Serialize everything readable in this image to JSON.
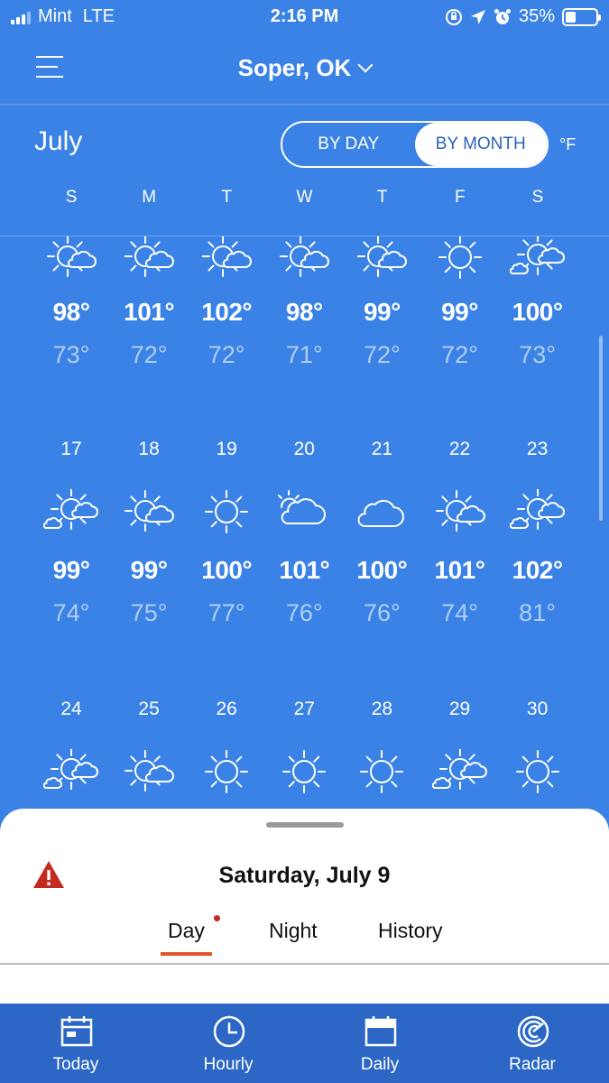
{
  "status_bar": {
    "carrier": "Mint",
    "network": "LTE",
    "time": "2:16 PM",
    "battery": "35%",
    "battery_level": 0.35
  },
  "header": {
    "location": "Soper, OK"
  },
  "calendar": {
    "month": "July",
    "toggle": {
      "by_day": "BY DAY",
      "by_month": "BY MONTH",
      "active": "by_month"
    },
    "unit": "°F",
    "weekdays": [
      "S",
      "M",
      "T",
      "W",
      "T",
      "F",
      "S"
    ],
    "weeks": [
      {
        "days": [
          {
            "date": "",
            "icon": "sun-cloud-icon",
            "hi": "98°",
            "lo": "73°"
          },
          {
            "date": "",
            "icon": "sun-cloud-icon",
            "hi": "101°",
            "lo": "72°"
          },
          {
            "date": "",
            "icon": "sun-cloud-icon",
            "hi": "102°",
            "lo": "72°"
          },
          {
            "date": "",
            "icon": "sun-cloud-icon",
            "hi": "98°",
            "lo": "71°"
          },
          {
            "date": "",
            "icon": "sun-cloud-icon",
            "hi": "99°",
            "lo": "72°"
          },
          {
            "date": "",
            "icon": "sun-icon",
            "hi": "99°",
            "lo": "72°"
          },
          {
            "date": "",
            "icon": "sun-clouds-icon",
            "hi": "100°",
            "lo": "73°"
          }
        ]
      },
      {
        "days": [
          {
            "date": "17",
            "icon": "sun-clouds-icon",
            "hi": "99°",
            "lo": "74°"
          },
          {
            "date": "18",
            "icon": "sun-cloud-icon",
            "hi": "99°",
            "lo": "75°"
          },
          {
            "date": "19",
            "icon": "sun-icon",
            "hi": "100°",
            "lo": "77°"
          },
          {
            "date": "20",
            "icon": "mostly-cloudy-icon",
            "hi": "101°",
            "lo": "76°"
          },
          {
            "date": "21",
            "icon": "cloud-icon",
            "hi": "100°",
            "lo": "76°"
          },
          {
            "date": "22",
            "icon": "sun-cloud-icon",
            "hi": "101°",
            "lo": "74°"
          },
          {
            "date": "23",
            "icon": "sun-clouds-icon",
            "hi": "102°",
            "lo": "81°"
          }
        ]
      },
      {
        "days": [
          {
            "date": "24",
            "icon": "sun-clouds-icon",
            "hi": "",
            "lo": ""
          },
          {
            "date": "25",
            "icon": "sun-cloud-icon",
            "hi": "",
            "lo": ""
          },
          {
            "date": "26",
            "icon": "sun-icon",
            "hi": "",
            "lo": ""
          },
          {
            "date": "27",
            "icon": "sun-icon",
            "hi": "",
            "lo": ""
          },
          {
            "date": "28",
            "icon": "sun-icon",
            "hi": "",
            "lo": ""
          },
          {
            "date": "29",
            "icon": "sun-clouds-icon",
            "hi": "",
            "lo": ""
          },
          {
            "date": "30",
            "icon": "sun-icon",
            "hi": "",
            "lo": ""
          }
        ]
      }
    ]
  },
  "sheet": {
    "title": "Saturday, July 9",
    "tabs": [
      "Day",
      "Night",
      "History"
    ],
    "active_tab": "Day"
  },
  "bottom_nav": {
    "items": [
      {
        "label": "Today",
        "icon": "calendar-today-icon"
      },
      {
        "label": "Hourly",
        "icon": "clock-icon"
      },
      {
        "label": "Daily",
        "icon": "calendar-daily-icon"
      },
      {
        "label": "Radar",
        "icon": "radar-icon"
      }
    ]
  },
  "colors": {
    "background": "#3a82e6",
    "nav": "#2c67c5",
    "accent": "#e1562b",
    "alert": "#c52a1f"
  }
}
